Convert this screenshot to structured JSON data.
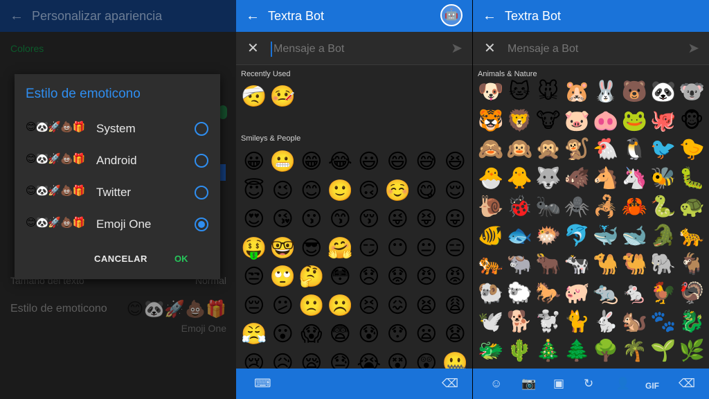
{
  "settings": {
    "title": "Personalizar apariencia",
    "section_colors": "Colores",
    "text_size_label": "Tamaño del texto",
    "text_size_value": "Normal",
    "emoji_style_label": "Estilo de emoticono",
    "emoji_style_value": "Emoji One",
    "emoji_preview": "😊🐼🚀💩🎁"
  },
  "dialog": {
    "title": "Estilo de emoticono",
    "options": [
      {
        "emojis": "😊🐼🚀💩🎁",
        "label": "System",
        "selected": false
      },
      {
        "emojis": "😊🐼🚀💩🎁",
        "label": "Android",
        "selected": false
      },
      {
        "emojis": "😊🐼🚀💩🎁",
        "label": "Twitter",
        "selected": false
      },
      {
        "emojis": "😊🐼🚀💩🎁",
        "label": "Emoji One",
        "selected": true
      }
    ],
    "cancel": "CANCELAR",
    "ok": "OK"
  },
  "chat1": {
    "title": "Textra Bot",
    "placeholder": "Mensaje a Bot",
    "recently_used_label": "Recently Used",
    "recently_used": [
      "🤕",
      "🤒"
    ],
    "smileys_label": "Smileys & People",
    "smileys": [
      "😀",
      "😬",
      "😁",
      "😂",
      "😃",
      "😄",
      "😅",
      "😆",
      "😇",
      "😉",
      "😊",
      "🙂",
      "🙃",
      "☺️",
      "😋",
      "😌",
      "😍",
      "😘",
      "😗",
      "😙",
      "😚",
      "😜",
      "😝",
      "😛",
      "🤑",
      "🤓",
      "😎",
      "🤗",
      "😏",
      "😶",
      "😐",
      "😑",
      "😒",
      "🙄",
      "🤔",
      "😳",
      "😞",
      "😟",
      "😠",
      "😡",
      "😔",
      "😕",
      "🙁",
      "☹️",
      "😣",
      "😖",
      "😫",
      "😩",
      "😤",
      "😮",
      "😱",
      "😨",
      "😰",
      "😯",
      "😦",
      "😧",
      "😢",
      "😥",
      "😪",
      "😓",
      "😭",
      "😵",
      "😲",
      "🤐"
    ]
  },
  "chat2": {
    "title": "Textra Bot",
    "placeholder": "Mensaje a Bot",
    "animals_label": "Animals & Nature",
    "animals": [
      "🐶",
      "🐱",
      "🐭",
      "🐹",
      "🐰",
      "🐻",
      "🐼",
      "🐨",
      "🐯",
      "🦁",
      "🐮",
      "🐷",
      "🐽",
      "🐸",
      "🐙",
      "🐵",
      "🙈",
      "🙉",
      "🙊",
      "🐒",
      "🐔",
      "🐧",
      "🐦",
      "🐤",
      "🐣",
      "🐥",
      "🐺",
      "🐗",
      "🐴",
      "🦄",
      "🐝",
      "🐛",
      "🐌",
      "🐞",
      "🐜",
      "🕷️",
      "🦂",
      "🦀",
      "🐍",
      "🐢",
      "🐠",
      "🐟",
      "🐡",
      "🐬",
      "🐳",
      "🐋",
      "🐊",
      "🐆",
      "🐅",
      "🐃",
      "🐂",
      "🐄",
      "🐪",
      "🐫",
      "🐘",
      "🐐",
      "🐏",
      "🐑",
      "🐎",
      "🐖",
      "🐀",
      "🐁",
      "🐓",
      "🦃",
      "🕊️",
      "🐕",
      "🐩",
      "🐈",
      "🐇",
      "🐿️",
      "🐾",
      "🐉",
      "🐲",
      "🌵",
      "🎄",
      "🌲",
      "🌳",
      "🌴",
      "🌱",
      "🌿"
    ],
    "toolbar_icons": [
      "smiley-icon",
      "camera-icon",
      "image-icon",
      "history-icon",
      "contact-icon",
      "gif-icon",
      "backspace-icon"
    ],
    "gif_label": "GIF"
  }
}
